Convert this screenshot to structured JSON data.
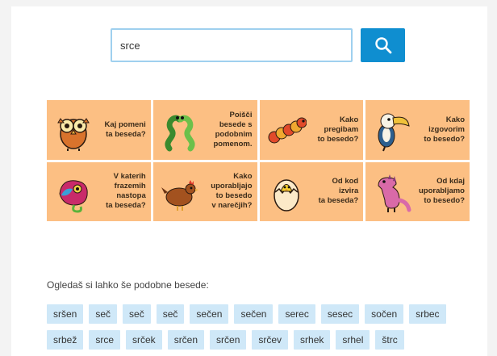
{
  "search": {
    "value": "srce"
  },
  "colors": {
    "accent": "#0f8ed0",
    "tile_orange": "#fcbf83",
    "tile_blue": "#bfe0f6",
    "chip": "#cfe8f8"
  },
  "tiles": [
    {
      "label": "Kaj pomeni\nta beseda?",
      "icon": "owl-icon",
      "color": "orange"
    },
    {
      "label": "Poišči\nbesede s\npodobnim\npomenom.",
      "icon": "snakes-icon",
      "color": "orange"
    },
    {
      "label": "Kako\npregibam\nto besedo?",
      "icon": "caterpillar-icon",
      "color": "orange"
    },
    {
      "label": "Kako\nizgovorim\nto besedo?",
      "icon": "toucan-icon",
      "color": "orange"
    },
    {
      "label": "V katerih\nfrazemih\nnastopa\nta beseda?",
      "icon": "chameleon-icon",
      "color": "orange"
    },
    {
      "label": "Kako\nuporabljajo\nto besedo\nv narečjih?",
      "icon": "hen-icon",
      "color": "orange"
    },
    {
      "label": "Od kod\nizvira\nta beseda?",
      "icon": "hatching-egg-icon",
      "color": "orange"
    },
    {
      "label": "Od kdaj\nuporabljamo\nto besedo?",
      "icon": "dinosaur-icon",
      "color": "orange"
    }
  ],
  "similar": {
    "label": "Ogledaš si lahko še podobne besede:",
    "words": [
      "sršen",
      "seč",
      "seč",
      "seč",
      "sečen",
      "sečen",
      "serec",
      "sesec",
      "sočen",
      "srbec",
      "srbež",
      "srce",
      "srček",
      "srčen",
      "srčen",
      "srčev",
      "srhek",
      "srhel",
      "štrc"
    ]
  }
}
